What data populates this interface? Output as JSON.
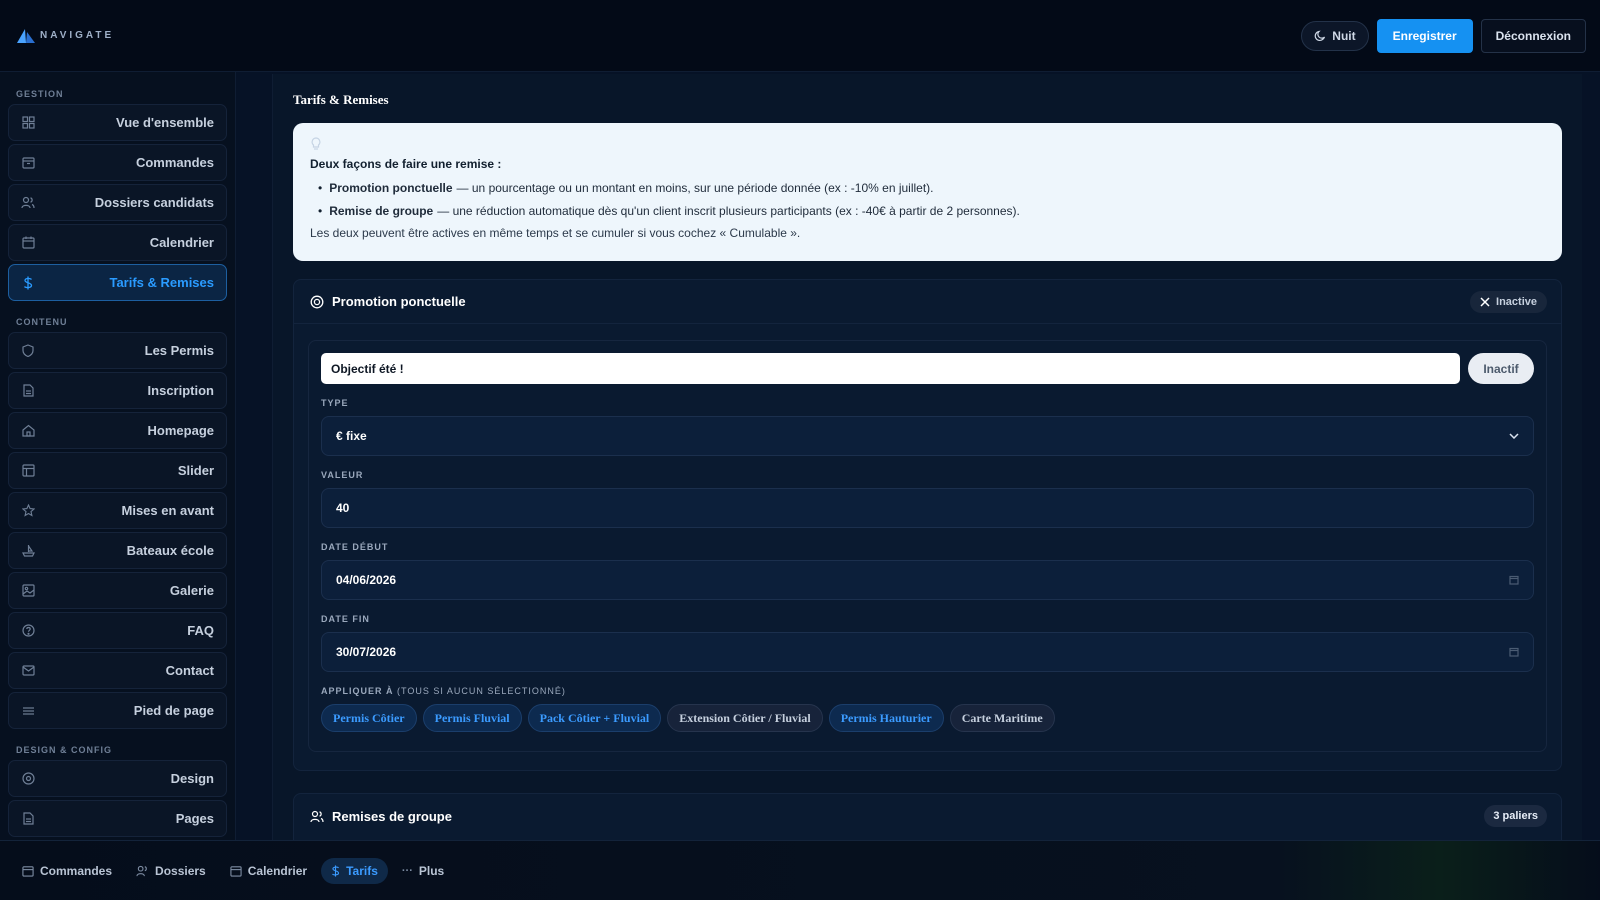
{
  "brand": {
    "name": "NAVIGATE"
  },
  "topbar": {
    "night_label": "Nuit",
    "save_label": "Enregistrer",
    "logout_label": "Déconnexion"
  },
  "sidebar": {
    "sections": [
      {
        "title": "GESTION",
        "items": [
          {
            "label": "Vue d'ensemble",
            "icon": "grid-icon"
          },
          {
            "label": "Commandes",
            "icon": "box-icon"
          },
          {
            "label": "Dossiers candidats",
            "icon": "users-icon"
          },
          {
            "label": "Calendrier",
            "icon": "calendar-icon"
          },
          {
            "label": "Tarifs & Remises",
            "icon": "dollar-icon",
            "active": true
          }
        ]
      },
      {
        "title": "CONTENU",
        "items": [
          {
            "label": "Les Permis",
            "icon": "shield-icon"
          },
          {
            "label": "Inscription",
            "icon": "document-icon"
          },
          {
            "label": "Homepage",
            "icon": "home-icon"
          },
          {
            "label": "Slider",
            "icon": "layout-icon"
          },
          {
            "label": "Mises en avant",
            "icon": "star-icon"
          },
          {
            "label": "Bateaux école",
            "icon": "boat-icon"
          },
          {
            "label": "Galerie",
            "icon": "image-icon"
          },
          {
            "label": "FAQ",
            "icon": "help-icon"
          },
          {
            "label": "Contact",
            "icon": "mail-icon"
          },
          {
            "label": "Pied de page",
            "icon": "footer-icon"
          }
        ]
      },
      {
        "title": "DESIGN & CONFIG",
        "items": [
          {
            "label": "Design",
            "icon": "palette-icon"
          },
          {
            "label": "Pages",
            "icon": "pages-icon"
          }
        ]
      }
    ]
  },
  "main": {
    "title": "Tarifs & Remises",
    "info": {
      "heading": "Deux façons de faire une remise :",
      "items": [
        {
          "bold": "Promotion ponctuelle",
          "text": "— un pourcentage ou un montant en moins, sur une période donnée (ex : -10% en juillet)."
        },
        {
          "bold": "Remise de groupe",
          "text": "— une réduction automatique dès qu'un client inscrit plusieurs participants (ex : -40€ à partir de 2 personnes)."
        }
      ],
      "footer": "Les deux peuvent être actives en même temps et se cumuler si vous cochez « Cumulable »."
    },
    "promo": {
      "title": "Promotion ponctuelle",
      "status_badge": "Inactive",
      "name_value": "Objectif été !",
      "toggle_label": "Inactif",
      "type_label": "TYPE",
      "type_value": "€ fixe",
      "value_label": "VALEUR",
      "value_value": "40",
      "start_label": "DATE DÉBUT",
      "start_value": "04/06/2026",
      "end_label": "DATE FIN",
      "end_value": "30/07/2026",
      "apply_label": "APPLIQUER À",
      "apply_hint": "(TOUS SI AUCUN SÉLECTIONNÉ)",
      "chips": [
        {
          "label": "Permis Côtier",
          "selected": true
        },
        {
          "label": "Permis Fluvial",
          "selected": true
        },
        {
          "label": "Pack Côtier + Fluvial",
          "selected": true
        },
        {
          "label": "Extension Côtier / Fluvial",
          "selected": false
        },
        {
          "label": "Permis Hauturier",
          "selected": true
        },
        {
          "label": "Carte Maritime",
          "selected": false
        }
      ]
    },
    "group": {
      "title": "Remises de groupe",
      "badge": "3 paliers"
    }
  },
  "bottomnav": {
    "items": [
      {
        "label": "Commandes",
        "icon": "box-icon"
      },
      {
        "label": "Dossiers",
        "icon": "users-icon"
      },
      {
        "label": "Calendrier",
        "icon": "calendar-icon"
      },
      {
        "label": "Tarifs",
        "icon": "dollar-icon",
        "active": true
      },
      {
        "label": "Plus",
        "icon": "more-icon"
      }
    ]
  },
  "colors": {
    "accent": "#1591f2",
    "background": "#061226",
    "active_text": "#2a9bff"
  }
}
